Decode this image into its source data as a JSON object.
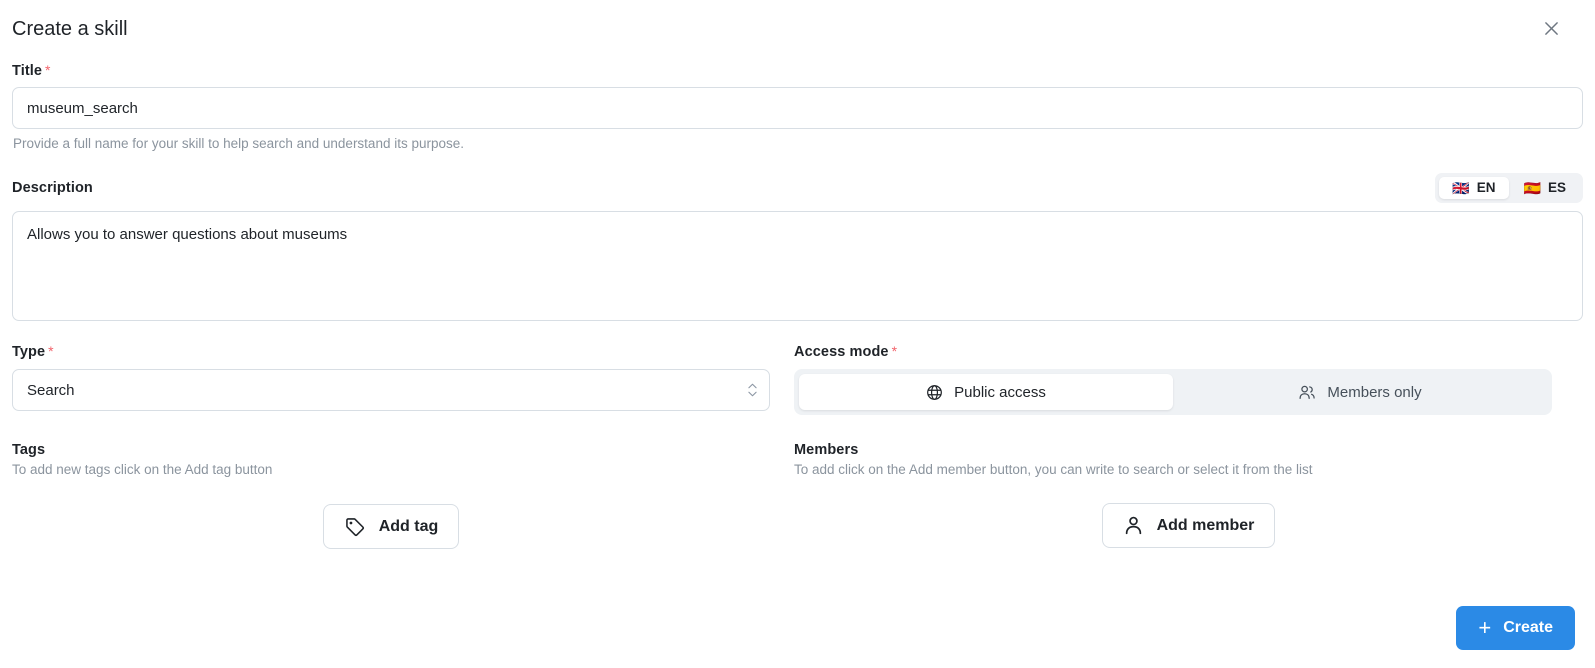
{
  "dialog": {
    "title": "Create a skill",
    "close_icon": "close-icon"
  },
  "title_field": {
    "label": "Title",
    "required_mark": "*",
    "value": "museum_search",
    "placeholder": "",
    "helper": "Provide a full name for your skill to help search and understand its purpose."
  },
  "description_field": {
    "label": "Description",
    "value": "Allows you to answer questions about museums",
    "placeholder": "",
    "languages": [
      {
        "code": "EN",
        "flag": "🇬🇧",
        "selected": true
      },
      {
        "code": "ES",
        "flag": "🇪🇸",
        "selected": false
      }
    ]
  },
  "type_field": {
    "label": "Type",
    "required_mark": "*",
    "value": "Search",
    "options": [
      "Search"
    ]
  },
  "access_mode_field": {
    "label": "Access mode",
    "required_mark": "*",
    "options": [
      {
        "label": "Public access",
        "icon": "globe-icon",
        "selected": true
      },
      {
        "label": "Members only",
        "icon": "people-icon",
        "selected": false
      }
    ]
  },
  "tags_section": {
    "label": "Tags",
    "helper": "To add new tags click on the Add tag button",
    "add_button": "Add tag",
    "add_button_icon": "tag-icon"
  },
  "members_section": {
    "label": "Members",
    "helper": "To add click on the Add member button, you can write to search or select it from the list",
    "add_button": "Add member",
    "add_button_icon": "person-icon"
  },
  "footer": {
    "create_label": "Create",
    "create_icon": "plus-icon"
  },
  "colors": {
    "accent": "#2b8ae6",
    "required": "#f2636b",
    "border": "#d8dee4",
    "track": "#eff2f5",
    "helper_text": "#8b949e"
  }
}
